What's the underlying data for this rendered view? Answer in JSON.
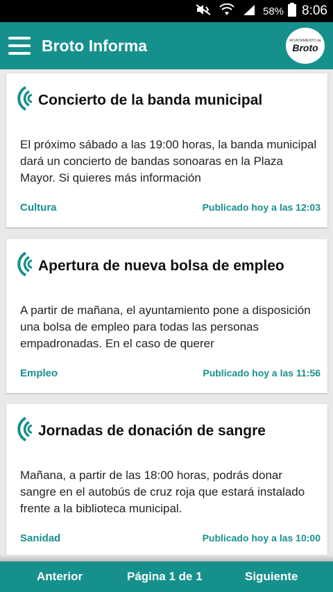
{
  "status_bar": {
    "battery": "58%",
    "time": "8:06",
    "icons": [
      "mute-vibrate-icon",
      "wifi-icon",
      "signal-icon",
      "battery-icon"
    ]
  },
  "app_bar": {
    "title": "Broto Informa",
    "menu_icon": "hamburger-icon",
    "logo_small_text": "AYUNTAMIENTO de",
    "logo_big_text": "Broto"
  },
  "colors": {
    "accent": "#16908d",
    "background": "#e9e9e9",
    "card": "#ffffff"
  },
  "news": [
    {
      "icon": "broadcast-icon",
      "title": "Concierto de la banda municipal",
      "body": "El próximo sábado a las 19:00 horas, la banda municipal dará un concierto de bandas sonoaras en la Plaza Mayor. Si quieres más información",
      "category": "Cultura",
      "published": "Publicado hoy a las 12:03"
    },
    {
      "icon": "broadcast-icon",
      "title": "Apertura de nueva bolsa de empleo",
      "body": "A partir de mañana, el ayuntamiento pone a disposición una bolsa de empleo para todas las personas empadronadas. En el caso de querer",
      "category": "Empleo",
      "published": "Publicado hoy a las 11:56"
    },
    {
      "icon": "broadcast-icon",
      "title": "Jornadas de donación de sangre",
      "body": "Mañana, a partir de las 18:00 horas, podrás donar sangre en el autobús de cruz roja que estará instalado frente a la biblioteca municipal.",
      "category": "Sanidad",
      "published": "Publicado hoy a las 10:00"
    }
  ],
  "pagination": {
    "prev": "Anterior",
    "page": "Página 1 de 1",
    "next": "Siguiente"
  }
}
